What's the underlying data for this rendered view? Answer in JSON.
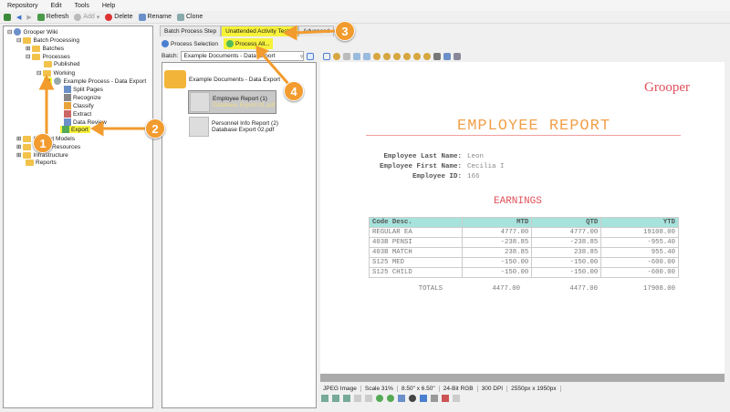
{
  "menu": [
    "Repository",
    "Edit",
    "Tools",
    "Help"
  ],
  "toolbar": {
    "refresh": "Refresh",
    "add": "Add",
    "delete": "Delete",
    "rename": "Rename",
    "clone": "Clone"
  },
  "tree": {
    "root": "Grooper Wiki",
    "batch_processing": "Batch Processing",
    "batches": "Batches",
    "processes": "Processes",
    "published": "Published",
    "working": "Working",
    "process": "Example Process - Data Export",
    "steps": [
      "Split Pages",
      "Recognize",
      "Classify",
      "Extract",
      "Data Review",
      "Export"
    ],
    "content_models": "Content Models",
    "global_resources": "Global Resources",
    "infrastructure": "Infrastructure",
    "reports": "Reports"
  },
  "tabs": {
    "batch_process_step": "Batch Process Step",
    "unattended": "Unattended Activity Tester",
    "third": "Advanced"
  },
  "actions": {
    "process_selection": "Process Selection",
    "process_all": "Process All..."
  },
  "batch": {
    "label": "Batch:",
    "value": "Example Documents - Data Export"
  },
  "batch_tree": {
    "root": "Example Documents - Data Export",
    "docs": [
      {
        "name": "Employee Report (1)",
        "file": "Database Export 01.pdf"
      },
      {
        "name": "Personnel Info Report (2)",
        "file": "Database Export 02.pdf"
      }
    ]
  },
  "report": {
    "logo": "Grooper",
    "title": "EMPLOYEE REPORT",
    "fields": [
      {
        "label": "Employee Last Name:",
        "value": "Leon"
      },
      {
        "label": "Employee First Name:",
        "value": "Cecilia I"
      },
      {
        "label": "Employee ID:",
        "value": "166"
      }
    ],
    "earnings_title": "EARNINGS",
    "headers": [
      "Code Desc.",
      "MTD",
      "QTD",
      "YTD"
    ],
    "rows": [
      [
        "REGULAR EA",
        "4777.00",
        "4777.00",
        "19108.00"
      ],
      [
        "403B PENSI",
        "-238.85",
        "-238.85",
        "-955.40"
      ],
      [
        "403B MATCH",
        "238.85",
        "238.85",
        "955.40"
      ],
      [
        "S125 MED",
        "-150.00",
        "-150.00",
        "-600.00"
      ],
      [
        "S125 CHILD",
        "-150.00",
        "-150.00",
        "-600.00"
      ]
    ],
    "totals": [
      "TOTALS",
      "4477.00",
      "4477.00",
      "17908.00"
    ]
  },
  "status": [
    "JPEG Image",
    "Scale 31%",
    "8.50\" x 6.50\"",
    "24-Bit RGB",
    "300 DPI",
    "2550px x 1950px"
  ],
  "callouts": [
    "1",
    "2",
    "3",
    "4"
  ],
  "colors": {
    "accent": "#f29b2e",
    "highlight": "#f7f23a",
    "title": "#f0a04b",
    "earnings": "#e0505a",
    "table_header": "#a6e3dc"
  }
}
